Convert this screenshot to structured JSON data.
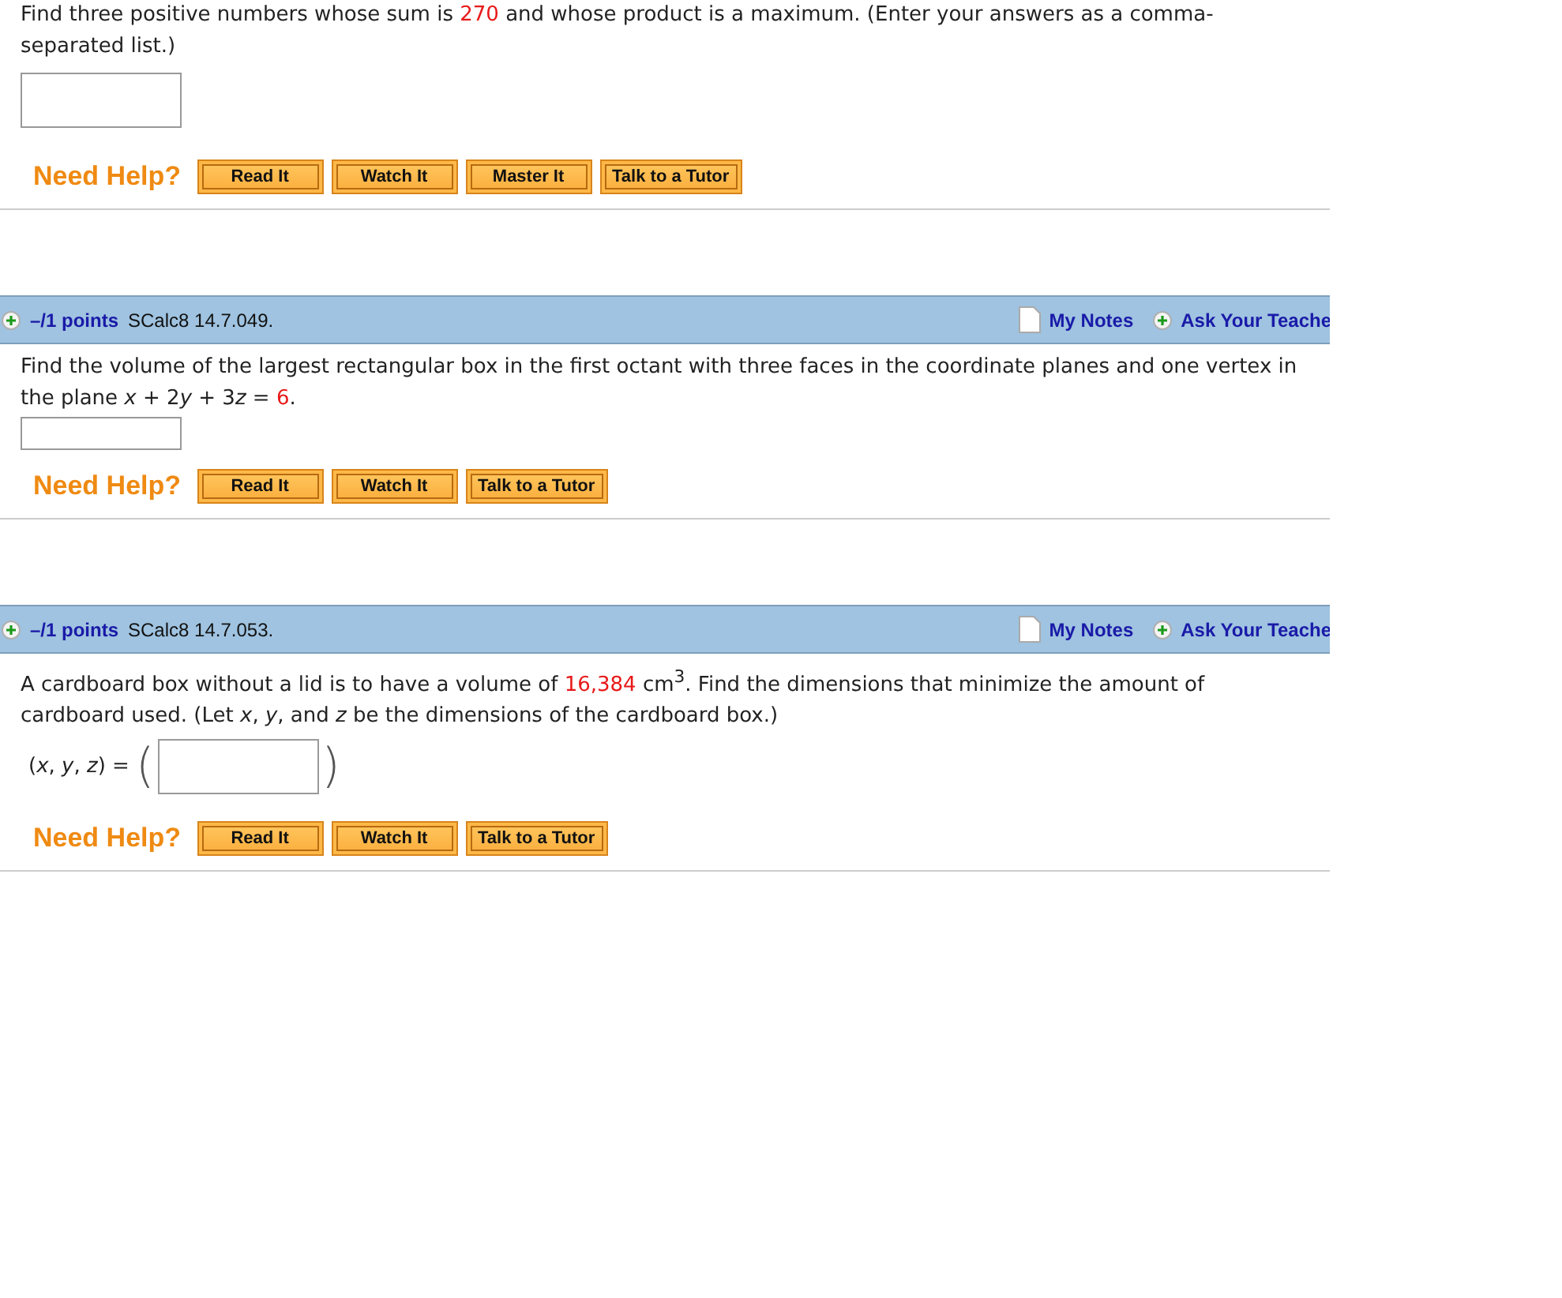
{
  "problems": [
    {
      "question": [
        {
          "kind": "text",
          "text": "Find three positive numbers whose sum is "
        },
        {
          "kind": "red",
          "text": "270"
        },
        {
          "kind": "text",
          "text": " and whose product is a maximum. (Enter your answers as a comma-separated list.)"
        }
      ],
      "answer": {
        "kind": "large"
      },
      "help": {
        "label": "Need Help?",
        "buttons": [
          "Read It",
          "Watch It",
          "Master It",
          "Talk to a Tutor"
        ]
      }
    },
    {
      "header": {
        "points": "–/1 points",
        "code": "SCalc8 14.7.049.",
        "notes": "My Notes",
        "ask": "Ask Your Teache"
      },
      "question": [
        {
          "kind": "text",
          "text": "Find the volume of the largest rectangular box in the first octant with three faces in the coordinate planes and one vertex in the plane  "
        },
        {
          "kind": "italic",
          "text": "x"
        },
        {
          "kind": "text",
          "text": " + 2"
        },
        {
          "kind": "italic",
          "text": "y"
        },
        {
          "kind": "text",
          "text": " + 3"
        },
        {
          "kind": "italic",
          "text": "z"
        },
        {
          "kind": "text",
          "text": " = "
        },
        {
          "kind": "red",
          "text": "6"
        },
        {
          "kind": "text",
          "text": "."
        }
      ],
      "answer": {
        "kind": "small"
      },
      "help": {
        "label": "Need Help?",
        "buttons": [
          "Read It",
          "Watch It",
          "Talk to a Tutor"
        ]
      }
    },
    {
      "header": {
        "points": "–/1 points",
        "code": "SCalc8 14.7.053.",
        "notes": "My Notes",
        "ask": "Ask Your Teache"
      },
      "question": [
        {
          "kind": "text",
          "text": "A cardboard box without a lid is to have a volume of "
        },
        {
          "kind": "red",
          "text": "16,384"
        },
        {
          "kind": "text",
          "text": " cm$^{3}$. Find the dimensions that minimize the amount of cardboard used. (Let *x*, *y*, and *z* be the dimensions of the cardboard box.)"
        }
      ],
      "answer": {
        "kind": "tuple",
        "prefix": "(*x*, *y*, *z*) =",
        "open": "(",
        "close": ")"
      },
      "help": {
        "label": "Need Help?",
        "buttons": [
          "Read It",
          "Watch It",
          "Talk to a Tutor"
        ]
      }
    }
  ]
}
